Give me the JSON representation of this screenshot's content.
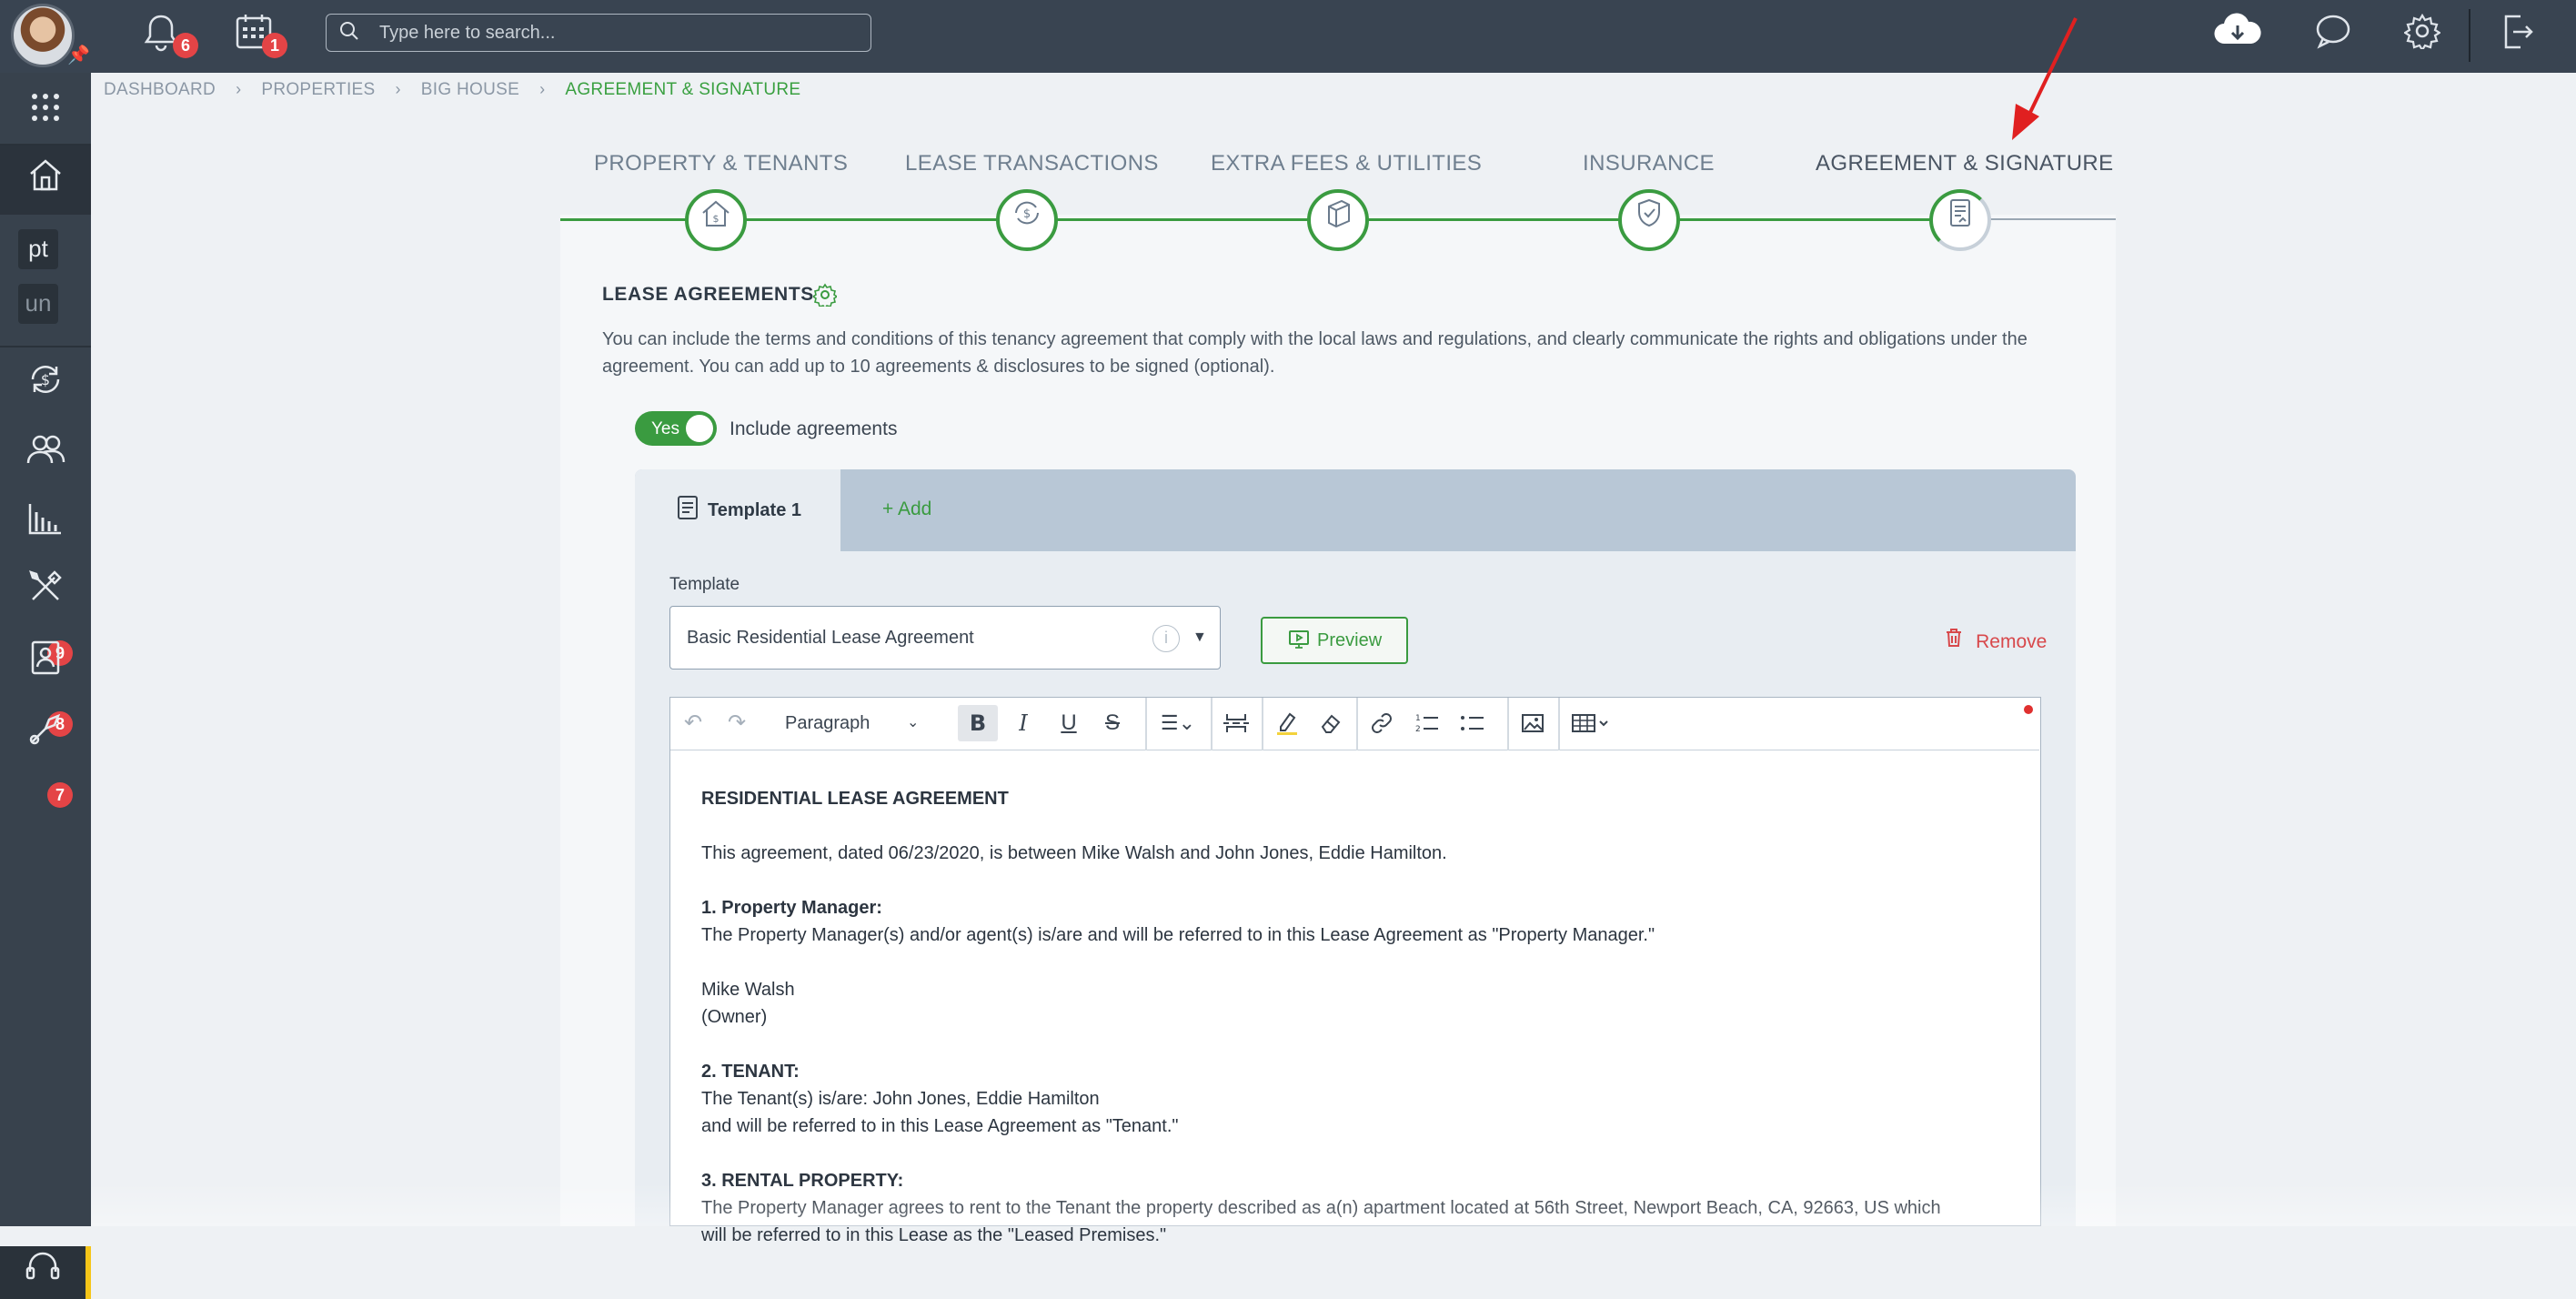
{
  "topbar": {
    "notifications_count": "6",
    "calendar_count": "1",
    "search_placeholder": "Type here to search...",
    "icons": [
      "bell-icon",
      "calendar-icon",
      "cloud-download-icon",
      "chat-icon",
      "gear-icon",
      "logout-icon"
    ]
  },
  "sidebar": {
    "items": [
      {
        "name": "apps-grid-icon"
      },
      {
        "name": "home-icon"
      },
      {
        "text": "pt"
      },
      {
        "text": "un"
      },
      {
        "name": "transactions-icon"
      },
      {
        "name": "people-icon"
      },
      {
        "name": "reports-icon"
      },
      {
        "name": "tools-icon",
        "badge": "9"
      },
      {
        "name": "contacts-icon",
        "badge": "8"
      },
      {
        "name": "maintenance-icon",
        "badge": "7"
      },
      {
        "name": "support-icon"
      }
    ]
  },
  "breadcrumb": [
    "DASHBOARD",
    "PROPERTIES",
    "BIG HOUSE",
    "AGREEMENT & SIGNATURE"
  ],
  "steps": [
    {
      "label": "PROPERTY & TENANTS"
    },
    {
      "label": "LEASE TRANSACTIONS"
    },
    {
      "label": "EXTRA FEES & UTILITIES"
    },
    {
      "label": "INSURANCE"
    },
    {
      "label": "AGREEMENT & SIGNATURE",
      "active": true
    }
  ],
  "lease": {
    "title": "LEASE AGREEMENTS",
    "description": "You can include the terms and conditions of this tenancy agreement that comply with the local laws and regulations, and clearly communicate the rights and obligations under the agreement. You can add up to 10 agreements & disclosures to be signed (optional).",
    "toggle_label": "Yes",
    "toggle_text": "Include agreements",
    "tab_active": "Template 1",
    "tab_add": "+ Add",
    "template_label": "Template",
    "template_value": "Basic Residential Lease Agreement",
    "info": "i",
    "preview": "Preview",
    "remove": "Remove"
  },
  "editor": {
    "block_format": "Paragraph",
    "content": {
      "heading": "RESIDENTIAL LEASE AGREEMENT",
      "intro": "This agreement, dated 06/23/2020, is between Mike Walsh and John Jones, Eddie Hamilton.",
      "s1_title": "1. Property Manager:",
      "s1_text": "The Property Manager(s) and/or agent(s) is/are and will be referred to in this Lease Agreement as \"Property Manager.\"",
      "owner_name": "Mike Walsh",
      "owner_role": "(Owner)",
      "s2_title": "2. TENANT:",
      "s2_line1": "The Tenant(s) is/are: John Jones, Eddie Hamilton",
      "s2_line2": "and will be referred to in this Lease Agreement as \"Tenant.\"",
      "s3_title": "3. RENTAL PROPERTY:",
      "s3_line1": "The Property Manager agrees to rent to the Tenant the property described as a(n) apartment located at 56th Street, Newport Beach, CA, 92663, US which",
      "s3_line2": "will be referred to in this Lease as the \"Leased Premises.\""
    }
  },
  "colors": {
    "accent": "#3a9b40",
    "danger": "#d8484b",
    "topbar": "#394451",
    "sidebar": "#38424d"
  }
}
